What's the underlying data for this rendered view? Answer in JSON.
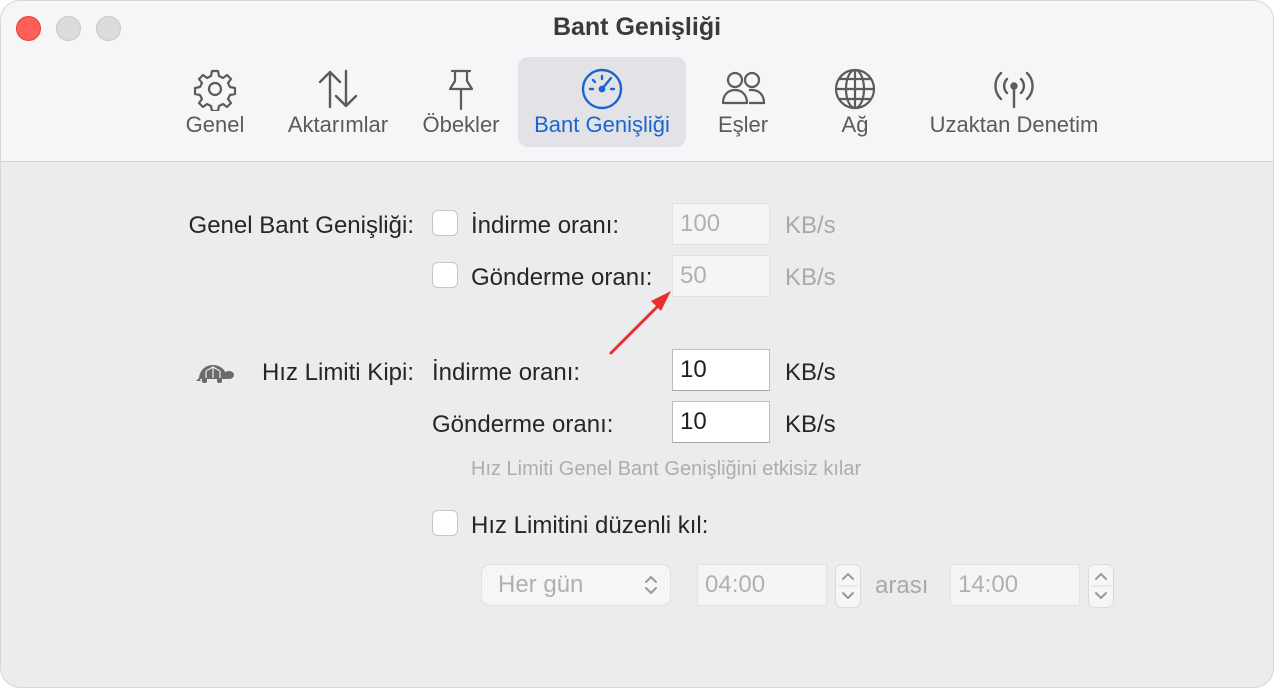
{
  "window": {
    "title": "Bant Genişliği"
  },
  "tabs": [
    {
      "label": "Genel",
      "icon": "gear-icon"
    },
    {
      "label": "Aktarımlar",
      "icon": "transfer-arrows-icon"
    },
    {
      "label": "Öbekler",
      "icon": "pin-icon"
    },
    {
      "label": "Bant Genişliği",
      "icon": "speedometer-icon",
      "active": true
    },
    {
      "label": "Eşler",
      "icon": "people-icon"
    },
    {
      "label": "Ağ",
      "icon": "globe-icon"
    },
    {
      "label": "Uzaktan Denetim",
      "icon": "antenna-icon"
    }
  ],
  "global_bandwidth": {
    "section_label": "Genel Bant Genişliği:",
    "download": {
      "label": "İndirme oranı:",
      "value": "100",
      "unit": "KB/s",
      "checked": false
    },
    "upload": {
      "label": "Gönderme oranı:",
      "value": "50",
      "unit": "KB/s",
      "checked": false
    }
  },
  "speed_limit": {
    "section_label": "Hız Limiti Kipi:",
    "icon": "turtle-icon",
    "download": {
      "label": "İndirme oranı:",
      "value": "10",
      "unit": "KB/s"
    },
    "upload": {
      "label": "Gönderme oranı:",
      "value": "10",
      "unit": "KB/s"
    },
    "hint": "Hız Limiti Genel Bant Genişliğini etkisiz kılar"
  },
  "schedule": {
    "label": "Hız Limitini düzenli kıl:",
    "checked": false,
    "day": "Her gün",
    "from": "04:00",
    "between_label": "arası",
    "to": "14:00"
  },
  "colors": {
    "accent": "#1966d2",
    "annotation_arrow": "#e8312a",
    "close": "#fe5f57"
  }
}
